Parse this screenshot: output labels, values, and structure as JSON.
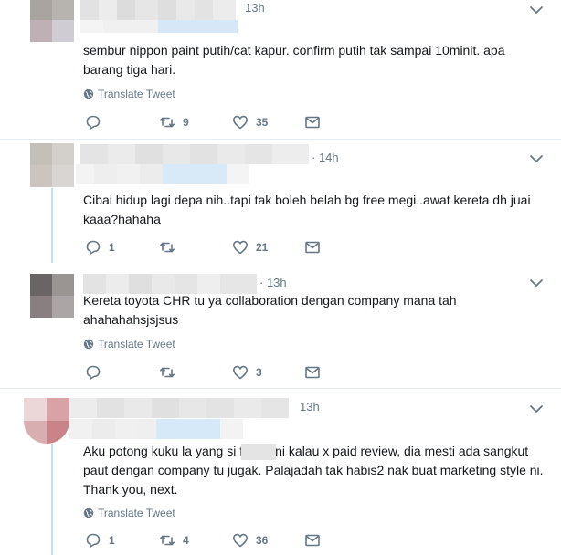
{
  "colors": {
    "text": "#14171a",
    "muted": "#657786",
    "divider": "#e6ecf0",
    "thread_line": "#c2dff5"
  },
  "tweets": [
    {
      "time": "13h",
      "body": "sembur nippon paint putih/cat kapur. confirm putih tak sampai 10minit. apa\nbarang tiga hari.",
      "translate": "Translate Tweet",
      "reply_count": "",
      "retweet_count": "9",
      "like_count": "35"
    },
    {
      "time": "· 14h",
      "body": "Cibai hidup lagi depa nih..tapi tak boleh belah bg free megi..awat kereta dh juai\nkaaa?hahaha",
      "translate": "",
      "reply_count": "1",
      "retweet_count": "",
      "like_count": "21"
    },
    {
      "time": "· 13h",
      "body": "Kereta toyota CHR tu ya collaboration dengan company mana tah\nahahahahsjsjsus",
      "translate": "Translate Tweet",
      "reply_count": "",
      "retweet_count": "",
      "like_count": "3"
    },
    {
      "time": "13h",
      "body": "Aku potong kuku la yang si f      e ni kalau x paid review, dia mesti ada sangkut\npaut dengan company tu jugak. Palajadah tak habis2 nak buat marketing style ni.\nThank you, next.",
      "translate": "Translate Tweet",
      "reply_count": "1",
      "retweet_count": "4",
      "like_count": "36"
    }
  ],
  "icons": {
    "reply": "reply-icon",
    "retweet": "retweet-icon",
    "like": "heart-icon",
    "dm": "envelope-icon",
    "globe": "globe-icon",
    "caret": "chevron-down-icon"
  }
}
